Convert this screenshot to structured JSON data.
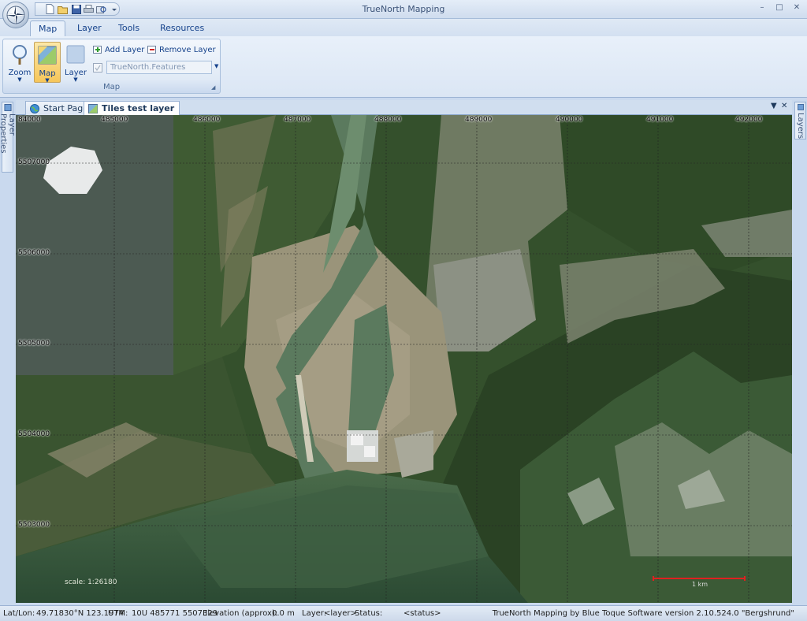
{
  "window": {
    "title": "TrueNorth Mapping",
    "minimize_glyph": "–",
    "restore_glyph": "□",
    "close_glyph": "✕"
  },
  "ribbon": {
    "tabs": [
      {
        "label": "Map",
        "active": true
      },
      {
        "label": "Layer",
        "active": false
      },
      {
        "label": "Tools",
        "active": false
      },
      {
        "label": "Resources",
        "active": false
      }
    ],
    "map_group": {
      "label": "Map",
      "zoom_label": "Zoom",
      "map_label": "Map",
      "layer_label": "Layer",
      "add_layer_label": "Add Layer",
      "remove_layer_label": "Remove Layer",
      "feature_combo_value": "TrueNorth.Features"
    }
  },
  "side_tabs": {
    "left": "Layer Properties",
    "right": "Layers"
  },
  "doc_tabs": [
    {
      "label": "Start Page",
      "active": false
    },
    {
      "label": "Tiles test layer",
      "active": true
    }
  ],
  "doc_controls": {
    "menu_glyph": "▼",
    "close_glyph": "✕"
  },
  "map": {
    "easting_labels": [
      "84000",
      "485000",
      "486000",
      "487000",
      "488000",
      "489000",
      "490000",
      "491000",
      "492000"
    ],
    "northing_labels": [
      "5507000",
      "5506000",
      "5505000",
      "5504000",
      "5503000"
    ],
    "scale_text": "scale: 1:26180",
    "scalebar_label": "1 km",
    "colors": {
      "forest": "#2f4a27",
      "water_dark": "#2e4a34",
      "water_light": "#6d8d6e",
      "delta": "#a59d84",
      "town": "#8c9184",
      "rock": "#bfc5ba",
      "scalebar": "#e02020"
    }
  },
  "status": {
    "latlon_label": "Lat/Lon:",
    "latlon_value": "49.71830°N 123.1974",
    "utm_label": "UTM:",
    "utm_value": "10U 485771 5507329",
    "elevation_label": "Elevation (approx):",
    "elevation_value": "0.0 m",
    "layer_label": "Layer:",
    "layer_value": "<layer>",
    "status_label": "Status:",
    "status_value": "<status>",
    "version_text": "TrueNorth Mapping by Blue Toque Software version 2.10.524.0 \"Bergshrund\""
  }
}
